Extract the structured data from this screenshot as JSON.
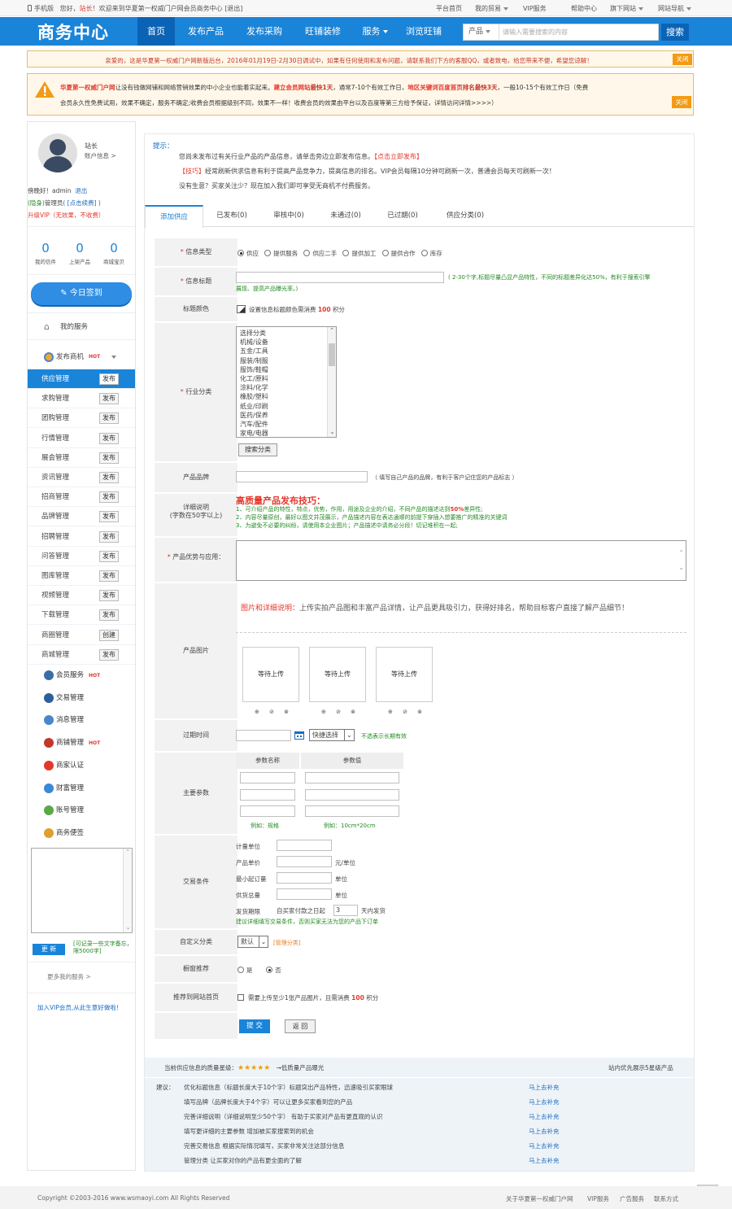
{
  "topbar": {
    "mobile": "手机版",
    "greeting_prefix": "您好，",
    "user": "站长",
    "greeting_suffix": "！欢迎来到华夏第一权威门户网会员商务中心",
    "logout": "[退出]",
    "links": [
      "平台首页",
      "我的贸易",
      "VIP服务",
      "帮助中心",
      "旗下网站",
      "网站导航"
    ]
  },
  "header": {
    "logo": "商务中心",
    "nav": [
      "首页",
      "发布产品",
      "发布采购",
      "旺铺装修",
      "服务",
      "浏览旺铺"
    ],
    "search": {
      "category": "产品",
      "placeholder": "请输入需要搜索的内容",
      "button": "搜索"
    }
  },
  "notice1": {
    "text": "亲爱的，这是华夏第一权威门户网新版后台，2016年01月19日-2月30日调试中，如果有任何使用和发布问题，请联系我们下方的客服QQ，或者致电，给您带来不便，希望您谅解！",
    "close": "关闭"
  },
  "notice2": {
    "p1": "华夏第一权威门户网",
    "p2": "让没有钱做网铺和网络营销效果的中小企业也能着实起来。",
    "p3": "建立会员网站",
    "p4": "最快1天",
    "p5": "，通常7-10个有效工作日，",
    "p6": "地区关键词百度首页",
    "p7": "排名最快3天",
    "p8": "，一般10-15个有效工作日（免费",
    "line2": "会员永久性免费试用，效果不确定，服务不确定;收费会员根据级别不同，效果不一样！收费会员的效果由平台以及百度等第三方给予保证，详情访问详情>>>>）",
    "close": "关闭"
  },
  "profile": {
    "name": "站长",
    "account_info": "账户信息 >",
    "hello": "傍晚好！admin",
    "logout": "退出",
    "hidden": "(隐身)",
    "role": "管理员",
    "login_link": "( [点击续费] )",
    "upgrade": "升级VIP（无效果，不收费）",
    "stats": [
      {
        "value": "0",
        "label": "我的信件"
      },
      {
        "value": "0",
        "label": "上架产品"
      },
      {
        "value": "0",
        "label": "商城宝贝"
      }
    ],
    "sign_button": "今日签到"
  },
  "menu": {
    "my_services": "我的服务",
    "publish": "发布商机",
    "hot": "HOT",
    "items": [
      {
        "label": "供应管理",
        "btn": "发布"
      },
      {
        "label": "求购管理",
        "btn": "发布"
      },
      {
        "label": "团购管理",
        "btn": "发布"
      },
      {
        "label": "行情管理",
        "btn": "发布"
      },
      {
        "label": "展会管理",
        "btn": "发布"
      },
      {
        "label": "资讯管理",
        "btn": "发布"
      },
      {
        "label": "招商管理",
        "btn": "发布"
      },
      {
        "label": "品牌管理",
        "btn": "发布"
      },
      {
        "label": "招聘管理",
        "btn": "发布"
      },
      {
        "label": "问答管理",
        "btn": "发布"
      },
      {
        "label": "图库管理",
        "btn": "发布"
      },
      {
        "label": "视频管理",
        "btn": "发布"
      },
      {
        "label": "下载管理",
        "btn": "发布"
      },
      {
        "label": "商圈管理",
        "btn": "创建"
      },
      {
        "label": "商城管理",
        "btn": "发布"
      }
    ],
    "services": [
      {
        "label": "会员服务",
        "hot": true,
        "color": "#3a6ea5"
      },
      {
        "label": "交易管理",
        "hot": false,
        "color": "#2d5f9a"
      },
      {
        "label": "消息管理",
        "hot": false,
        "color": "#4a86c8"
      },
      {
        "label": "商铺管理",
        "hot": true,
        "color": "#c0392b"
      },
      {
        "label": "商家认证",
        "hot": false,
        "color": "#e2382c"
      },
      {
        "label": "财富管理",
        "hot": false,
        "color": "#3b88d6"
      },
      {
        "label": "账号管理",
        "hot": false,
        "color": "#5aa84a"
      },
      {
        "label": "商务便签",
        "hot": false,
        "color": "#e0a030"
      }
    ],
    "update_button": "更 新",
    "note_hint": "[可记录一些文字备忘，限5000字]",
    "more": "更多我的服务  >",
    "vip": "加入VIP会员,从此生意好做啦！"
  },
  "tip": {
    "title": "提示：",
    "line1": "您尚未发布过有关行业产品的产品信息，请单击旁边立即发布信息。",
    "line1_link": "【点击立即发布】",
    "line2_tag": "【技巧】",
    "line2": "经常刷新供求信息有利于提高产品竞争力，提高信息的排名。VIP会员每隔10分钟可刷新一次，普通会员每天可刷新一次！",
    "line3": "没有生意？买家关注少？现在加入我们即可享受无商机不付费服务。"
  },
  "tabs": [
    "添加供应",
    "已发布(0)",
    "审核中(0)",
    "未通过(0)",
    "已过期(0)",
    "供应分类(0)"
  ],
  "form": {
    "info_type": {
      "label": "信息类型",
      "options": [
        "供应",
        "提供服务",
        "供应二手",
        "提供加工",
        "提供合作",
        "库存"
      ]
    },
    "title": {
      "label": "信息标题",
      "hint": "( 2-30个字,标题尽量凸显产品特性，不同的标题差异化达50%，有利于搜索引擎",
      "hint2": "展现、提高产品曝光率。)"
    },
    "title_color": {
      "label": "标题颜色",
      "text": "设置信息标题颜色需消费",
      "points": "100",
      "unit": "积分"
    },
    "industry": {
      "label": "行业分类",
      "options": [
        "选择分类",
        "机械/设备",
        "五金/工具",
        "服装/制服",
        "服饰/鞋帽",
        "化工/原料",
        "涂料/化学",
        "橡胶/塑料",
        "纸业/印刷",
        "医药/保养",
        "汽车/配件",
        "家电/电器"
      ],
      "button": "搜索分类"
    },
    "brand": {
      "label": "产品品牌",
      "hint": "（ 填写自己产品的品牌，有利于客户记住您的产品标志 ）"
    },
    "desc": {
      "label": "详细说明",
      "sub": "(字数在50字以上)",
      "tips_title": "高质量产品发布技巧：",
      "tip1a": "1、可介绍产品的特性，特点，优势，作用，用途及企业的介绍，不同产品的描述达到",
      "tip1b": "50%",
      "tip1c": "差异性;",
      "tip2": "2、内容尽量原创，最好以图文并茂展示，产品描述内容在表达通顺的前提下穿插入想要推广的精准的关键词",
      "tip3": "3、为避免不必要的纠纷，请使用本企业图片；产品描述中请务必分段！切记堆积在一起;"
    },
    "advantage": {
      "label": "产品优势与应用："
    },
    "pics": {
      "label": "产品图片",
      "desc_title": "图片和详细说明：",
      "desc": "上传实拍产品图和丰富产品详情，让产品更具吸引力，获得好排名，帮助目标客户直接了解产品细节！",
      "boxes": [
        "等待上传",
        "等待上传",
        "等待上传"
      ],
      "icons": "⊕ ⊘ ⊗"
    },
    "expire": {
      "label": "过期时间",
      "select": "快捷选择",
      "hint": "不选表示长期有效"
    },
    "params": {
      "label": "主要参数",
      "col1": "参数名称",
      "col2": "参数值",
      "ex1": "例如：规格",
      "ex2": "例如：10cm*20cm"
    },
    "trade": {
      "label": "交易条件",
      "unit": "计量单位",
      "price": "产品单价",
      "price_unit": "元/单位",
      "min": "最小起订量",
      "min_unit": "单位",
      "supply": "供货总量",
      "supply_unit": "单位",
      "ship": "发货期限",
      "ship_a": "自买家付款之日起",
      "ship_days": "3",
      "ship_b": "天内发货",
      "hint": "建议详细填写交易条件，否则买家无法为您的产品下订单"
    },
    "custom_cat": {
      "label": "自定义分类",
      "select": "默认",
      "link": "[管理分类]"
    },
    "recommend": {
      "label": "橱窗推荐",
      "yes": "是",
      "no": "否"
    },
    "homepage": {
      "label": "推荐到网站首页",
      "text": "需要上传至少1张产品图片，且需消费",
      "points": "100",
      "unit": "积分"
    },
    "submit": "提 交",
    "back": "返 回"
  },
  "quality": {
    "label": "当前供应信息的质量星级：",
    "stars": "★★★★★",
    "link": "→低质量产品曝光",
    "right": "站内优先展示5星级产品",
    "prefix": "建议：",
    "rows": [
      {
        "text": "优化标题信息（标题长度大于10个字）标题突出产品特性，迅速吸引买家眼球",
        "action": "马上去补充"
      },
      {
        "text": "填写品牌（品牌长度大于4个字）可以让更多买家看到您的产品",
        "action": "马上去补充"
      },
      {
        "text": "完善详细说明（详细说明至少50个字） 有助于买家对产品有更直观的认识",
        "action": "马上去补充"
      },
      {
        "text": "填写更详细的主要参数 增加被买家搜索到的机会",
        "action": "马上去补充"
      },
      {
        "text": "完善交易信息 根据实际情况填写，买家非常关注这部分信息",
        "action": "马上去补充"
      },
      {
        "text": "管理分类 让买家对你的产品有更全面的了解",
        "action": "马上去补充"
      }
    ]
  },
  "footer": {
    "copy": "Copyright ©2003-2016 www.wsmaoyi.com All Rights Reserved",
    "links": [
      "关于华夏第一权威门户网",
      "VIP服务",
      "广告服务",
      "联系方式"
    ]
  }
}
